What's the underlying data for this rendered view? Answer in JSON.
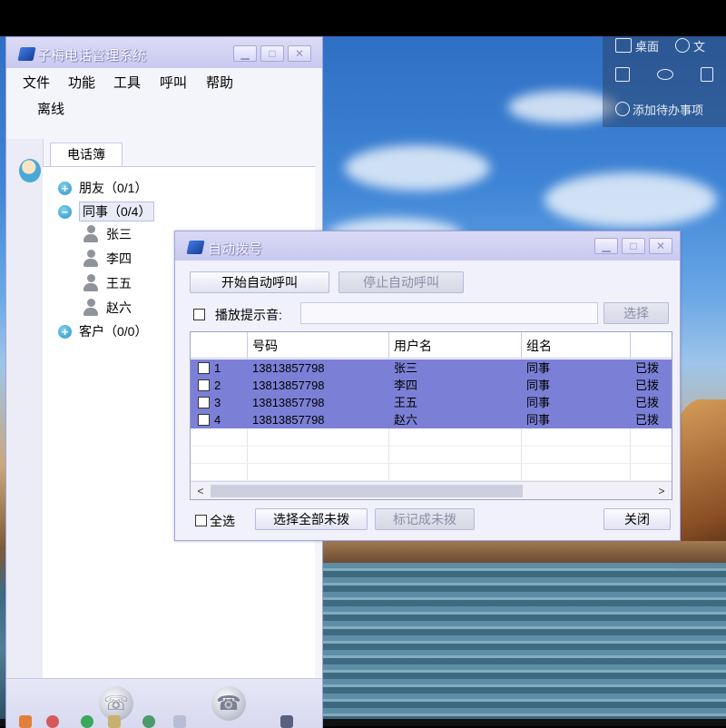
{
  "desktop_widget": {
    "item1": "桌面",
    "item2": "文",
    "add_todo": "添加待办事项"
  },
  "main_window": {
    "title": "子梅电话管理系统",
    "menu": [
      "文件",
      "功能",
      "工具",
      "呼叫",
      "帮助"
    ],
    "status": "离线",
    "tab": "电话簿",
    "groups": [
      {
        "label": "朋友（0/1）",
        "icon": "plus",
        "expanded": false
      },
      {
        "label": "同事（0/4）",
        "icon": "minus",
        "expanded": true,
        "members": [
          "张三",
          "李四",
          "王五",
          "赵六"
        ]
      },
      {
        "label": "客户（0/0）",
        "icon": "plus",
        "expanded": false
      }
    ]
  },
  "dialog": {
    "title": "自动拨号",
    "start_button": "开始自动呼叫",
    "stop_button": "停止自动呼叫",
    "play_prompt_label": "播放提示音:",
    "play_prompt_value": "",
    "choose_button": "选择",
    "columns": [
      "号码",
      "用户名",
      "组名",
      ""
    ],
    "rows": [
      {
        "index": "1",
        "number": "13813857798",
        "user": "张三",
        "group": "同事",
        "status": "已拨"
      },
      {
        "index": "2",
        "number": "13813857798",
        "user": "李四",
        "group": "同事",
        "status": "已拨"
      },
      {
        "index": "3",
        "number": "13813857798",
        "user": "王五",
        "group": "同事",
        "status": "已拨"
      },
      {
        "index": "4",
        "number": "13813857798",
        "user": "赵六",
        "group": "同事",
        "status": "已拨"
      }
    ],
    "select_all_label": "全选",
    "select_undialed_button": "选择全部未拨",
    "mark_undialed_button": "标记成未拨",
    "close_button": "关闭"
  },
  "colors": {
    "row_selected": "#7b80d6",
    "title_bar": "#c9c9ef"
  }
}
